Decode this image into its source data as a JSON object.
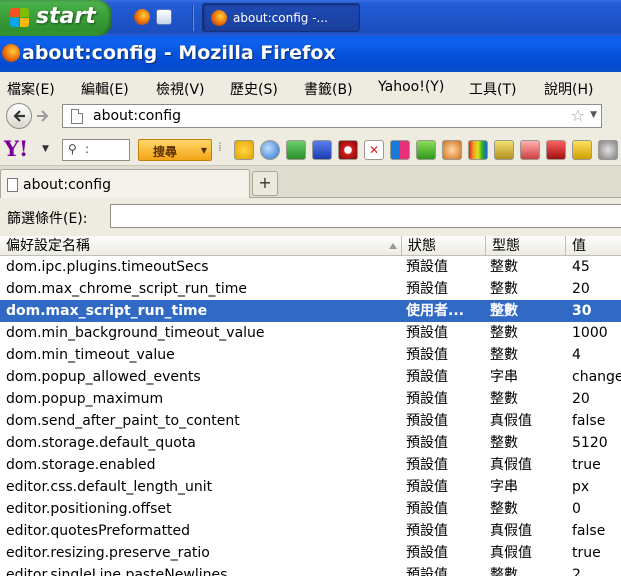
{
  "taskbar": {
    "start_label": "start",
    "task_button_label": "about:config -..."
  },
  "window": {
    "title": "about:config - Mozilla Firefox"
  },
  "menubar": {
    "items": [
      "檔案(E)",
      "編輯(E)",
      "檢視(V)",
      "歷史(S)",
      "書籤(B)",
      "Yahoo!(Y)",
      "工具(T)",
      "說明(H)"
    ]
  },
  "navbar": {
    "url": "about:config"
  },
  "yahoo_toolbar": {
    "logo": "Y!",
    "search_button_label": "搜尋"
  },
  "tabs": [
    {
      "label": "about:config"
    }
  ],
  "filter": {
    "label": "篩選條件(E):",
    "value": ""
  },
  "table": {
    "columns": [
      "偏好設定名稱",
      "狀態",
      "型態",
      "值"
    ],
    "rows": [
      {
        "name": "dom.ipc.plugins.timeoutSecs",
        "status": "預設值",
        "type": "整數",
        "value": "45"
      },
      {
        "name": "dom.max_chrome_script_run_time",
        "status": "預設值",
        "type": "整數",
        "value": "20"
      },
      {
        "name": "dom.max_script_run_time",
        "status": "使用者...",
        "type": "整數",
        "value": "30",
        "selected": true
      },
      {
        "name": "dom.min_background_timeout_value",
        "status": "預設值",
        "type": "整數",
        "value": "1000"
      },
      {
        "name": "dom.min_timeout_value",
        "status": "預設值",
        "type": "整數",
        "value": "4"
      },
      {
        "name": "dom.popup_allowed_events",
        "status": "預設值",
        "type": "字串",
        "value": "change"
      },
      {
        "name": "dom.popup_maximum",
        "status": "預設值",
        "type": "整數",
        "value": "20"
      },
      {
        "name": "dom.send_after_paint_to_content",
        "status": "預設值",
        "type": "真假值",
        "value": "false"
      },
      {
        "name": "dom.storage.default_quota",
        "status": "預設值",
        "type": "整數",
        "value": "5120"
      },
      {
        "name": "dom.storage.enabled",
        "status": "預設值",
        "type": "真假值",
        "value": "true"
      },
      {
        "name": "editor.css.default_length_unit",
        "status": "預設值",
        "type": "字串",
        "value": "px"
      },
      {
        "name": "editor.positioning.offset",
        "status": "預設值",
        "type": "整數",
        "value": "0"
      },
      {
        "name": "editor.quotesPreformatted",
        "status": "預設值",
        "type": "真假值",
        "value": "false"
      },
      {
        "name": "editor.resizing.preserve_ratio",
        "status": "預設值",
        "type": "真假值",
        "value": "true"
      },
      {
        "name": "editor.singleLine.pasteNewlines",
        "status": "預設值",
        "type": "整數",
        "value": "2"
      }
    ]
  },
  "colors": {
    "selection": "#316ac5",
    "titlebar": "#0654dc",
    "start_button": "#3ba23b"
  }
}
